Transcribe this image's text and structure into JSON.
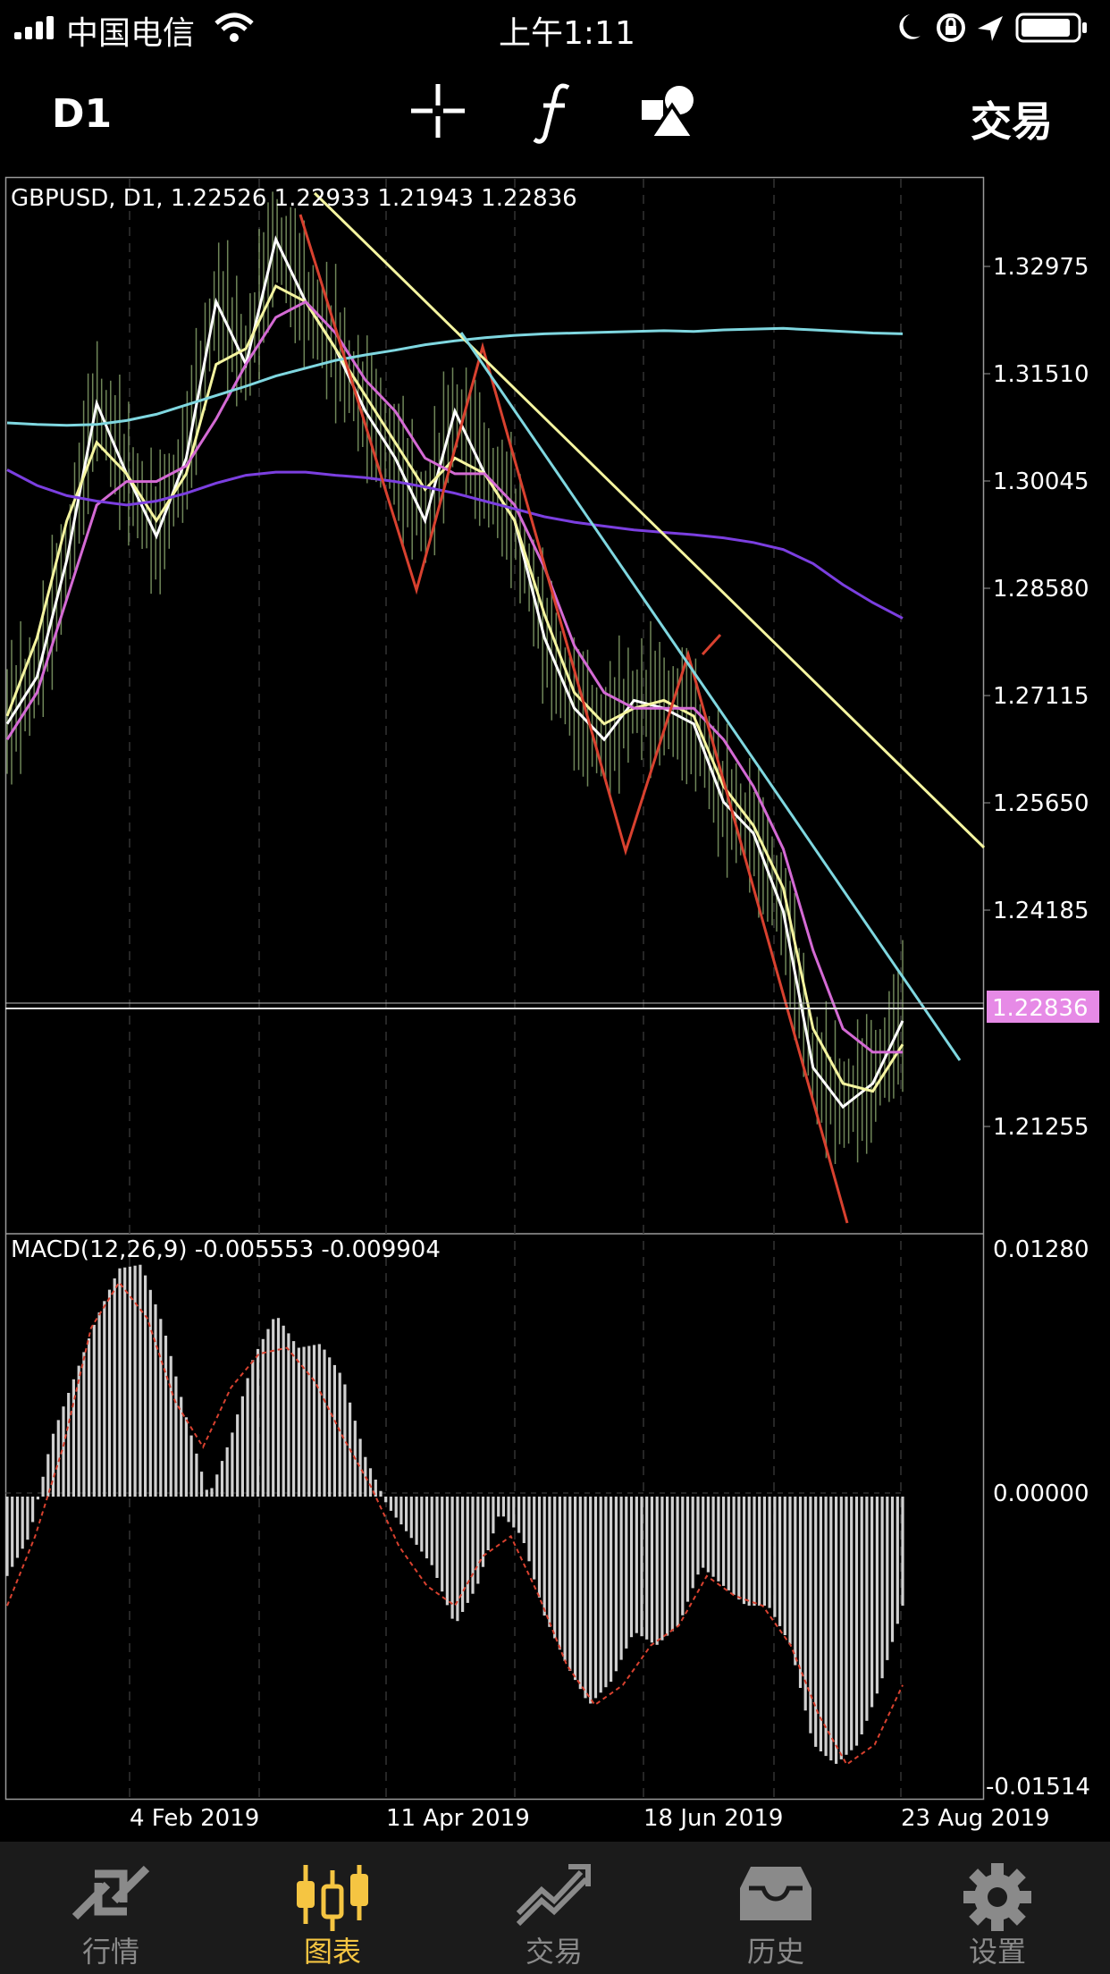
{
  "status_bar": {
    "carrier": "中国电信",
    "time": "上午1:11"
  },
  "toolbar": {
    "timeframe": "D1",
    "trade_label": "交易",
    "icons": [
      "crosshair-icon",
      "function-icon",
      "objects-icon"
    ]
  },
  "chart": {
    "symbol_line": "GBPUSD, D1, 1.22526 1.22933 1.21943 1.22836",
    "current_price": "1.22836",
    "price_ticks": [
      "1.32975",
      "1.31510",
      "1.30045",
      "1.28580",
      "1.27115",
      "1.25650",
      "1.24185",
      "1.21255"
    ],
    "date_ticks": [
      "4 Feb 2019",
      "11 Apr 2019",
      "18 Jun 2019",
      "23 Aug 2019"
    ],
    "macd_label": "MACD(12,26,9) -0.005553 -0.009904",
    "macd_ticks": [
      "0.01280",
      "0.00000",
      "-0.01514"
    ],
    "colors": {
      "price_label_bg": "#e68ae6",
      "aqua_ma": "#7fd7e0",
      "purple_ma": "#7b3fe0",
      "magenta_ma": "#d46ad4",
      "trend_red": "#d8412f",
      "trend_yellow": "#f5f5a0"
    }
  },
  "chart_data": {
    "type": "line",
    "symbol": "GBPUSD",
    "timeframe": "D1",
    "ohlc": {
      "open": 1.22526,
      "high": 1.22933,
      "low": 1.21943,
      "close": 1.22836
    },
    "yticks": [
      1.32975,
      1.3151,
      1.30045,
      1.2858,
      1.27115,
      1.2565,
      1.24185,
      1.21255
    ],
    "ylim": [
      1.199,
      1.3335
    ],
    "xticks": [
      "4 Feb 2019",
      "11 Apr 2019",
      "18 Jun 2019",
      "23 Aug 2019"
    ],
    "series": [
      {
        "values": [
          1.264,
          1.27,
          1.285,
          1.305,
          1.296,
          1.288,
          1.298,
          1.318,
          1.31,
          1.326,
          1.318,
          1.312,
          1.304,
          1.298,
          1.29,
          1.304,
          1.296,
          1.29,
          1.275,
          1.266,
          1.262,
          1.267,
          1.266,
          1.264,
          1.254,
          1.25,
          1.24,
          1.22,
          1.215,
          1.218,
          1.226
        ]
      },
      {
        "values": [
          1.265,
          1.275,
          1.29,
          1.3,
          1.296,
          1.29,
          1.296,
          1.31,
          1.312,
          1.32,
          1.318,
          1.312,
          1.306,
          1.3,
          1.294,
          1.298,
          1.296,
          1.29,
          1.278,
          1.268,
          1.264,
          1.266,
          1.267,
          1.265,
          1.256,
          1.251,
          1.243,
          1.225,
          1.218,
          1.217,
          1.223
        ]
      },
      {
        "values": [
          1.262,
          1.268,
          1.28,
          1.292,
          1.295,
          1.295,
          1.297,
          1.303,
          1.31,
          1.316,
          1.318,
          1.314,
          1.308,
          1.304,
          1.298,
          1.296,
          1.296,
          1.292,
          1.284,
          1.274,
          1.268,
          1.266,
          1.266,
          1.266,
          1.262,
          1.256,
          1.248,
          1.235,
          1.225,
          1.222,
          1.222
        ]
      },
      {
        "values": [
          1.3025,
          1.3023,
          1.3022,
          1.3023,
          1.3028,
          1.3036,
          1.3048,
          1.306,
          1.3072,
          1.3085,
          1.3095,
          1.3105,
          1.3112,
          1.3118,
          1.3125,
          1.313,
          1.3134,
          1.3137,
          1.3139,
          1.314,
          1.3141,
          1.3142,
          1.3143,
          1.3142,
          1.3144,
          1.3145,
          1.3146,
          1.3144,
          1.3142,
          1.314,
          1.3139
        ]
      },
      {
        "values": [
          1.2965,
          1.2945,
          1.2932,
          1.2925,
          1.292,
          1.2925,
          1.2935,
          1.2948,
          1.2958,
          1.2962,
          1.2962,
          1.2958,
          1.2955,
          1.295,
          1.2943,
          1.2935,
          1.2925,
          1.2915,
          1.2905,
          1.2898,
          1.2893,
          1.2888,
          1.2885,
          1.2882,
          1.2878,
          1.2872,
          1.2863,
          1.2845,
          1.2818,
          1.2795,
          1.2775
        ]
      }
    ],
    "macd": {
      "ylim": [
        -0.01514,
        0.0128
      ],
      "histogram": [
        -0.004,
        -0.002,
        0.003,
        0.006,
        0.009,
        0.0115,
        0.0117,
        0.0085,
        0.004,
        0.0,
        0.003,
        0.007,
        0.0092,
        0.0075,
        0.0077,
        0.006,
        0.002,
        -0.0005,
        -0.002,
        -0.0035,
        -0.0065,
        -0.0045,
        -0.0008,
        -0.002,
        -0.006,
        -0.0085,
        -0.0105,
        -0.0093,
        -0.0068,
        -0.0075,
        -0.0065,
        -0.0035,
        -0.0045,
        -0.0055,
        -0.0055,
        -0.0075,
        -0.0125,
        -0.0135,
        -0.0125,
        -0.0095,
        -0.0055
      ],
      "signal": [
        -0.0055,
        -0.002,
        0.0025,
        0.0085,
        0.0108,
        0.009,
        0.0048,
        0.0025,
        0.0055,
        0.0072,
        0.0075,
        0.0058,
        0.003,
        0.0005,
        -0.0025,
        -0.0045,
        -0.0055,
        -0.003,
        -0.002,
        -0.005,
        -0.0085,
        -0.0105,
        -0.0095,
        -0.0075,
        -0.0065,
        -0.004,
        -0.005,
        -0.0055,
        -0.0075,
        -0.011,
        -0.0135,
        -0.0125,
        -0.0095
      ]
    }
  },
  "bottom_nav": {
    "items": [
      {
        "label": "行情",
        "icon": "quotes-icon"
      },
      {
        "label": "图表",
        "icon": "chart-icon"
      },
      {
        "label": "交易",
        "icon": "trade-icon"
      },
      {
        "label": "历史",
        "icon": "history-icon"
      },
      {
        "label": "设置",
        "icon": "settings-icon"
      }
    ],
    "active_index": 1
  }
}
